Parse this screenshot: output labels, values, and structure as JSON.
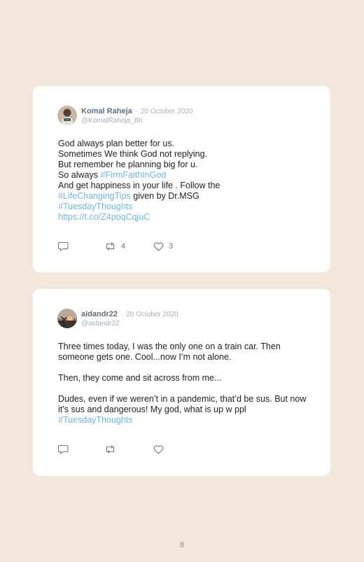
{
  "tweets": [
    {
      "name": "Komal Raheja",
      "separator": "·",
      "date": "20 October 2020",
      "handle": "@KomalRaheja_Bti",
      "lines": {
        "l1": "God always plan better for us.",
        "l2": "Sometimes We think God not replying.",
        "l3": "But remember he planning big for u.",
        "l4_text": "So always ",
        "l4_tag": "#FirmFaithInGod",
        "l5": "And get happiness in your life . Follow the",
        "l6_tag": "#LifeChangingTips",
        "l6_text": " given by Dr.MSG",
        "l7_tag": "#TuesdayThoughts",
        "l8_link": "https://t.co/Z4poqCqjuC"
      },
      "retweets": "4",
      "likes": "3"
    },
    {
      "name": "aidandr22",
      "separator": "·",
      "date": "20 October 2020",
      "handle": "@aidandr22",
      "lines": {
        "p1": "Three times today, I was the only one on a train car. Then someone gets one. Cool...now I’m not alone.",
        "p2": "Then, they come and sit across from me...",
        "p3": "Dudes, even if we weren’t in a pandemic, that’d be sus. But now it’s sus and dangerous! My god, what is up w ppl",
        "p3_tag": "#TuesdayThoughts"
      },
      "retweets": "",
      "likes": ""
    }
  ],
  "page_number": "8",
  "colors": {
    "background": "#f3e6da",
    "card": "#ffffff",
    "hashtag": "#6cb7e2",
    "name": "#5f6f7d"
  },
  "icons": {
    "reply": "reply-icon",
    "retweet": "retweet-icon",
    "like": "heart-icon"
  }
}
